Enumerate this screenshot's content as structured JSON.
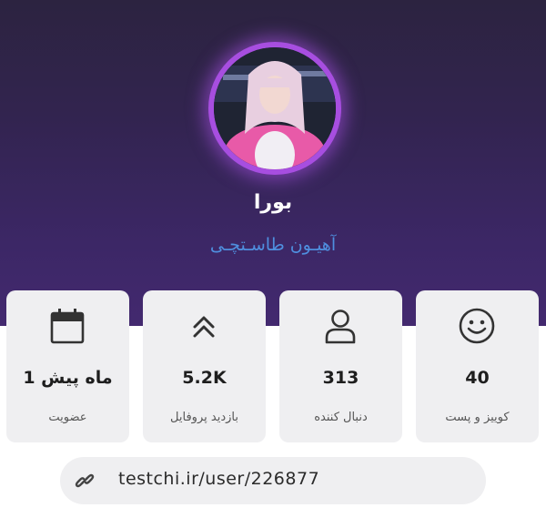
{
  "profile": {
    "name": "بورا",
    "username": "آهیـون طاسـتچـی",
    "avatar_icon": "profile-photo"
  },
  "stats": [
    {
      "icon": "smile-icon",
      "value": "40",
      "label": "کوییز و پست"
    },
    {
      "icon": "user-icon",
      "value": "313",
      "label": "دنبال کننده"
    },
    {
      "icon": "double-chevron-up-icon",
      "value": "5.2K",
      "label": "بازدید پروفایل"
    },
    {
      "icon": "calendar-icon",
      "value": "1 ماه پیش",
      "label": "عضویت"
    }
  ],
  "profile_link": {
    "icon": "link-icon",
    "url": "testchi.ir/user/226877"
  },
  "colors": {
    "hero_background": "#3c2766",
    "avatar_ring": "#a74ee0",
    "username": "#4f8fdf",
    "card_background": "#efeff1"
  }
}
